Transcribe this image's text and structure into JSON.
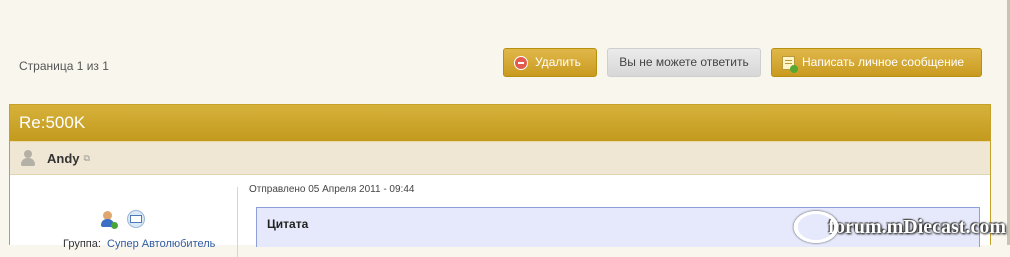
{
  "pager": {
    "label": "Страница 1 из 1"
  },
  "toolbar": {
    "delete_label": "Удалить",
    "noreply_label": "Вы не можете ответить",
    "pm_label": "Написать личное сообщение"
  },
  "post": {
    "title": "Re:500K",
    "author": "Andy",
    "posted": "Отправлено 05 Апреля 2011 - 09:44",
    "quote_label": "Цитата",
    "group_label": "Группа:",
    "group_value": "Супер Автолюбитель"
  },
  "watermark": {
    "text": "forum.mDiecast.com"
  },
  "icons": [
    "delete-icon",
    "message-add-icon",
    "avatar-icon",
    "external-link-icon",
    "user-add-icon",
    "mail-icon"
  ],
  "colors": {
    "gold": "#c99a1f",
    "author_bar": "#efe7d4",
    "quote_bg": "#e6e9fb"
  }
}
